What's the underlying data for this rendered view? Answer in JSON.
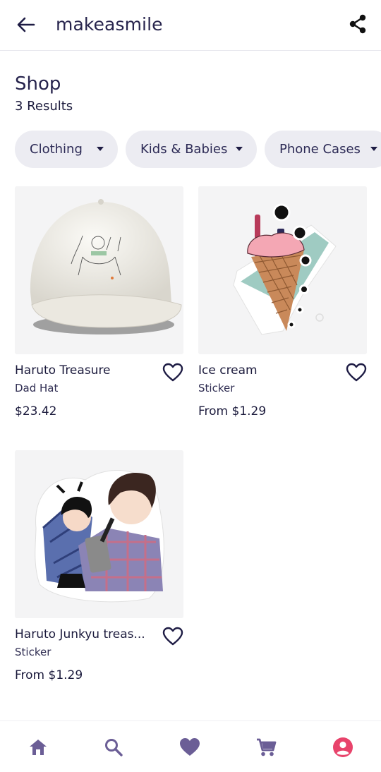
{
  "appbar": {
    "title": "makeasmile",
    "back_icon": "arrow-left-icon",
    "share_icon": "share-icon"
  },
  "page": {
    "heading": "Shop",
    "results": "3 Results"
  },
  "filters": [
    {
      "label": "Clothing"
    },
    {
      "label": "Kids & Babies"
    },
    {
      "label": "Phone Cases"
    }
  ],
  "products": [
    {
      "name": "Haruto Treasure",
      "type": "Dad Hat",
      "price": "$23.42",
      "image": "dad-hat-image"
    },
    {
      "name": "Ice cream",
      "type": "Sticker",
      "price": "From $1.29",
      "image": "ice-cream-sticker-image"
    },
    {
      "name": "Haruto Junkyu treas...",
      "type": "Sticker",
      "price": "From $1.29",
      "image": "couple-sticker-image"
    }
  ],
  "bottom_nav": [
    {
      "icon": "home-icon"
    },
    {
      "icon": "search-icon"
    },
    {
      "icon": "heart-icon"
    },
    {
      "icon": "cart-icon"
    },
    {
      "icon": "account-icon"
    }
  ],
  "colors": {
    "primary_text": "#1b1a3c",
    "chip_bg": "#ececf2",
    "nav_icon": "#6b5e96",
    "nav_active": "#e8436b"
  }
}
